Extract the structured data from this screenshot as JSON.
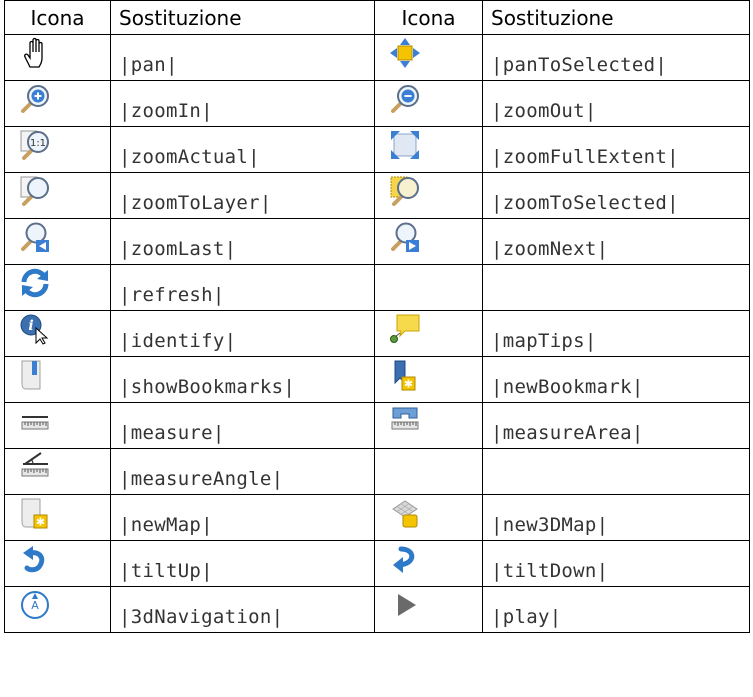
{
  "header": {
    "col1": "Icona",
    "col2": "Sostituzione",
    "col3": "Icona",
    "col4": "Sostituzione"
  },
  "rows": [
    {
      "left": {
        "icon": "hand-pan-icon",
        "code": "|pan|"
      },
      "right": {
        "icon": "pan-to-selected-icon",
        "code": "|panToSelected|"
      }
    },
    {
      "left": {
        "icon": "zoom-in-icon",
        "code": "|zoomIn|"
      },
      "right": {
        "icon": "zoom-out-icon",
        "code": "|zoomOut|"
      }
    },
    {
      "left": {
        "icon": "zoom-actual-icon",
        "code": "|zoomActual|"
      },
      "right": {
        "icon": "zoom-full-extent-icon",
        "code": "|zoomFullExtent|"
      }
    },
    {
      "left": {
        "icon": "zoom-to-layer-icon",
        "code": "|zoomToLayer|"
      },
      "right": {
        "icon": "zoom-to-selected-icon",
        "code": "|zoomToSelected|"
      }
    },
    {
      "left": {
        "icon": "zoom-last-icon",
        "code": "|zoomLast|"
      },
      "right": {
        "icon": "zoom-next-icon",
        "code": "|zoomNext|"
      }
    },
    {
      "left": {
        "icon": "refresh-icon",
        "code": "|refresh|"
      },
      "right": null
    },
    {
      "left": {
        "icon": "identify-icon",
        "code": "|identify|"
      },
      "right": {
        "icon": "map-tips-icon",
        "code": "|mapTips|"
      }
    },
    {
      "left": {
        "icon": "show-bookmarks-icon",
        "code": "|showBookmarks|"
      },
      "right": {
        "icon": "new-bookmark-icon",
        "code": "|newBookmark|"
      }
    },
    {
      "left": {
        "icon": "measure-icon",
        "code": "|measure|"
      },
      "right": {
        "icon": "measure-area-icon",
        "code": "|measureArea|"
      }
    },
    {
      "left": {
        "icon": "measure-angle-icon",
        "code": "|measureAngle|"
      },
      "right": null
    },
    {
      "left": {
        "icon": "new-map-icon",
        "code": "|newMap|"
      },
      "right": {
        "icon": "new-3d-map-icon",
        "code": "|new3DMap|"
      }
    },
    {
      "left": {
        "icon": "tilt-up-icon",
        "code": "|tiltUp|"
      },
      "right": {
        "icon": "tilt-down-icon",
        "code": "|tiltDown|"
      }
    },
    {
      "left": {
        "icon": "3d-navigation-icon",
        "code": "|3dNavigation|"
      },
      "right": {
        "icon": "play-icon",
        "code": "|play|"
      }
    }
  ],
  "colors": {
    "border": "#000000",
    "code_text": "#333333",
    "accent_blue": "#2f79c9",
    "accent_yellow": "#f5c400"
  }
}
